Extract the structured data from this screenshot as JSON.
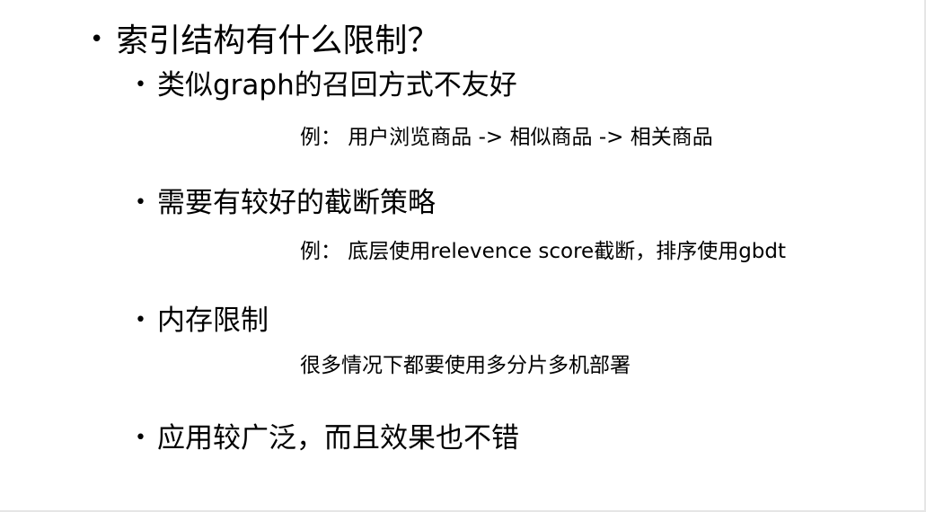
{
  "title": "索引结构有什么限制？",
  "bullet_glyph": "•",
  "points": [
    {
      "text": "类似graph的召回方式不友好",
      "example": "例：  用户浏览商品 -> 相似商品 -> 相关商品"
    },
    {
      "text": "需要有较好的截断策略",
      "example": "例：  底层使用relevence score截断，排序使用gbdt"
    },
    {
      "text": "内存限制",
      "example": "很多情况下都要使用多分片多机部署"
    },
    {
      "text": "应用较广泛，而且效果也不错"
    }
  ]
}
